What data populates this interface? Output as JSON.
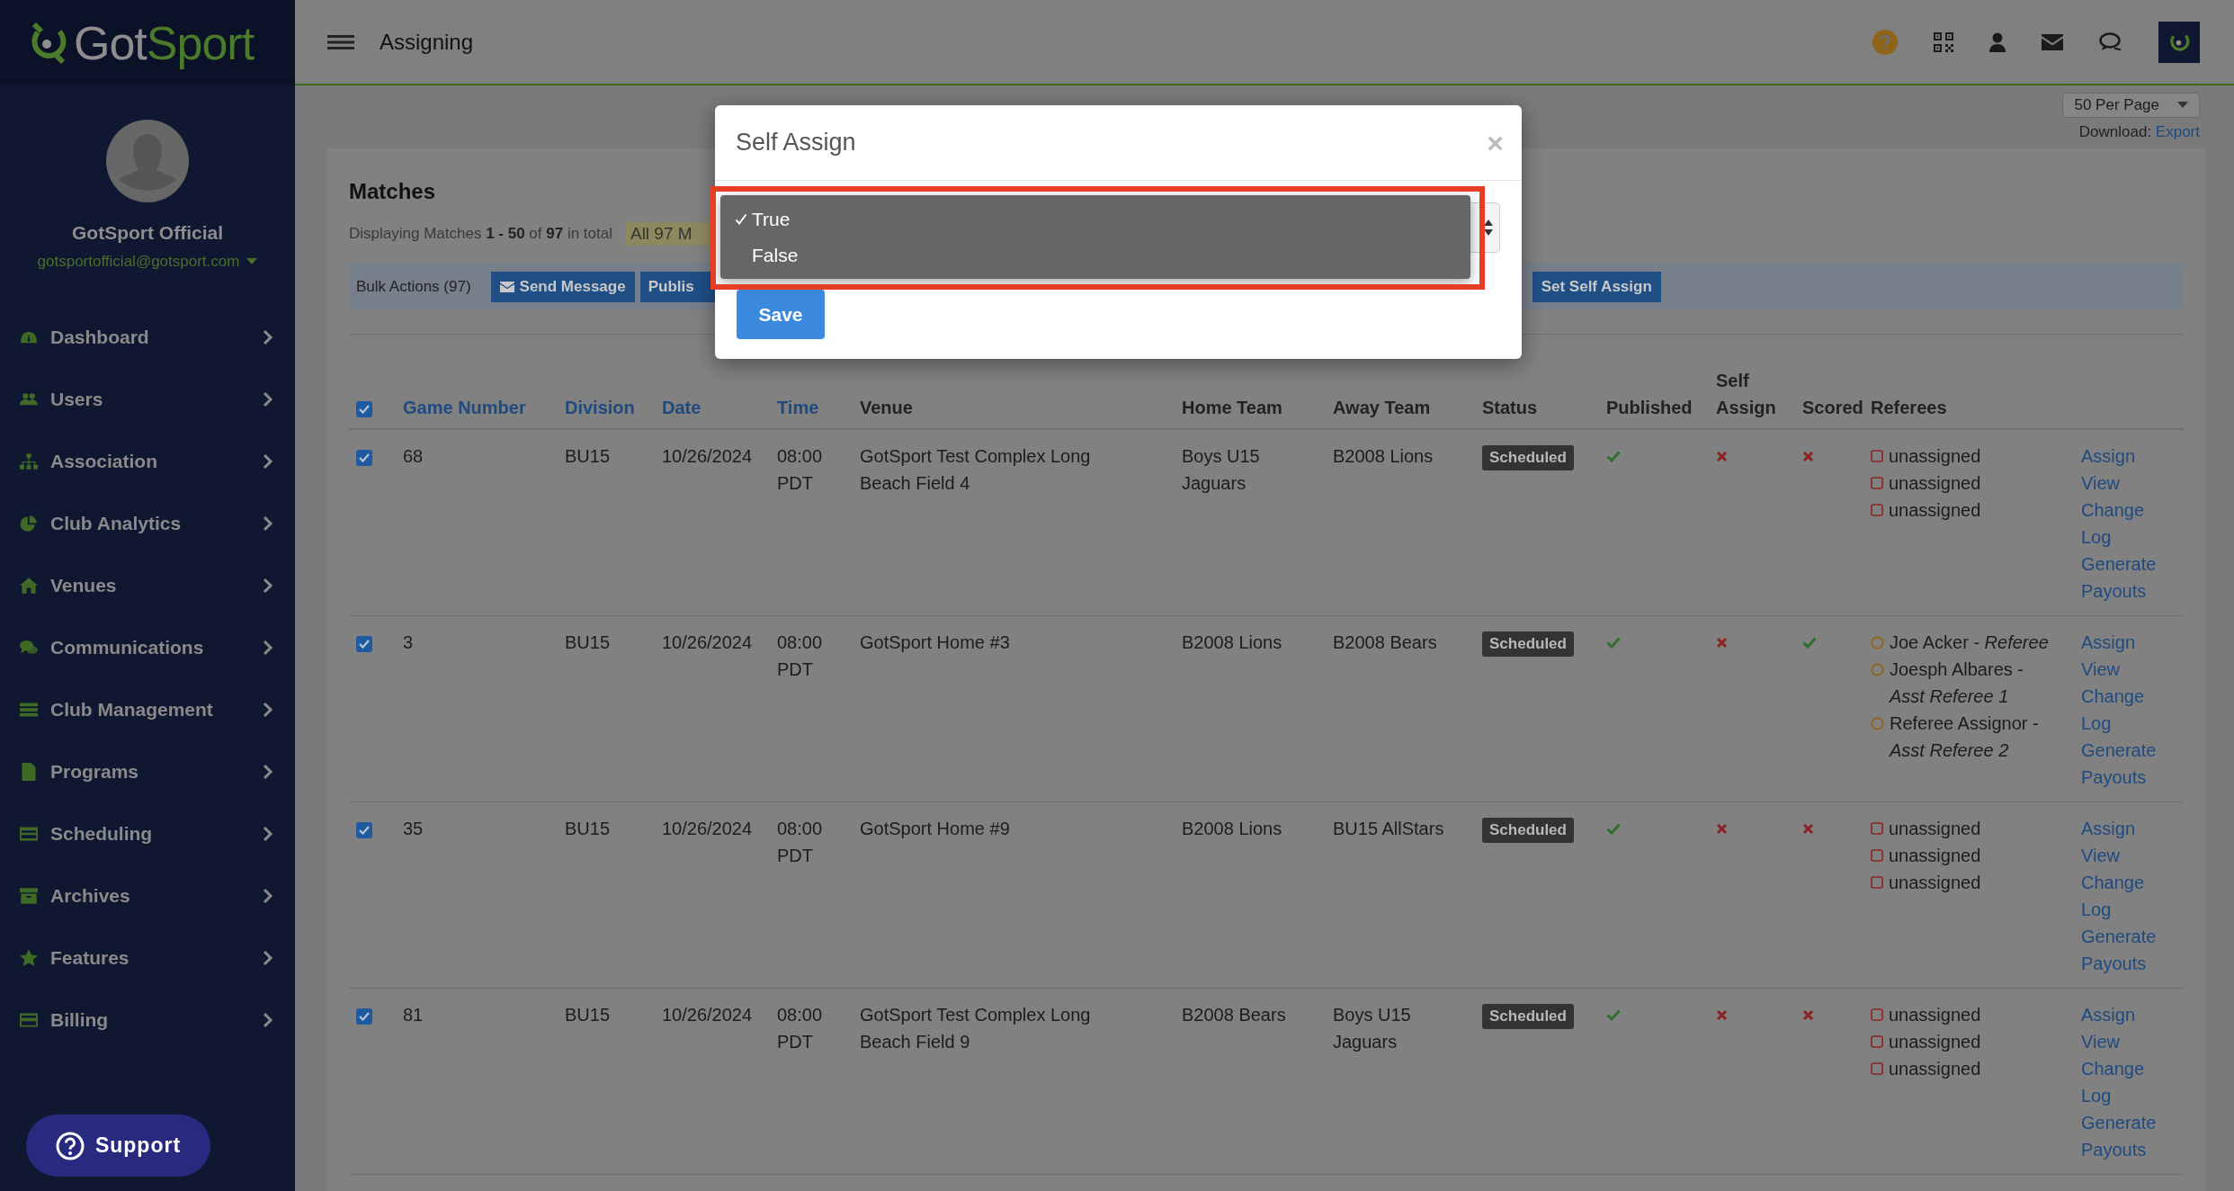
{
  "sidebar": {
    "logo": [
      {
        "text": "Got",
        "kind": "plain"
      },
      {
        "text": "Sport",
        "kind": "accent"
      }
    ],
    "user_name": "GotSport Official",
    "user_email": "gotsportofficial@gotsport.com",
    "items": [
      {
        "label": "Dashboard",
        "kind": "dashboard"
      },
      {
        "label": "Users",
        "kind": "users"
      },
      {
        "label": "Association",
        "kind": "association"
      },
      {
        "label": "Club Analytics",
        "kind": "analytics"
      },
      {
        "label": "Venues",
        "kind": "venues"
      },
      {
        "label": "Communications",
        "kind": "communications"
      },
      {
        "label": "Club Management",
        "kind": "management"
      },
      {
        "label": "Programs",
        "kind": "programs"
      },
      {
        "label": "Scheduling",
        "kind": "scheduling"
      },
      {
        "label": "Archives",
        "kind": "archives"
      },
      {
        "label": "Features",
        "kind": "features"
      },
      {
        "label": "Billing",
        "kind": "billing"
      }
    ],
    "support": "Support"
  },
  "header": {
    "title": "Assigning"
  },
  "toolbar": {
    "per_page": "50 Per Page",
    "download_label": "Download:",
    "download_link": "Export"
  },
  "matches": {
    "title": "Matches",
    "summary": "Displaying Matches **1 - 50** of **97** in total",
    "filter_chip": "All 97 M",
    "bulk_label": "Bulk Actions (97)",
    "bulk_buttons": [
      {
        "label": "Send Message",
        "kind": "envelope"
      },
      {
        "label": "Publis",
        "kind": "plain"
      },
      {
        "label": "Set Self Assign",
        "kind": "plain"
      }
    ],
    "select_all": true,
    "columns": [
      {
        "label": "Game Number",
        "sortable": true
      },
      {
        "label": "Division",
        "sortable": true
      },
      {
        "label": "Date",
        "sortable": true
      },
      {
        "label": "Time",
        "sortable": true
      },
      {
        "label": "Venue",
        "sortable": false
      },
      {
        "label": "Home Team",
        "sortable": false
      },
      {
        "label": "Away Team",
        "sortable": false
      },
      {
        "label": "Status",
        "sortable": false
      },
      {
        "label": "Published",
        "sortable": false
      },
      {
        "label": "Self Assign",
        "sortable": false
      },
      {
        "label": "Scored",
        "sortable": false
      },
      {
        "label": "Referees",
        "sortable": false
      }
    ],
    "rows": [
      {
        "checked": true,
        "game_number": "68",
        "division": "BU15",
        "date": "10/26/2024",
        "time": "08:00 PDT",
        "venue": "GotSport Test Complex Long Beach Field 4",
        "home_team": "Boys U15 Jaguars",
        "away_team": "B2008 Lions",
        "status": "Scheduled",
        "published": true,
        "self_assign": false,
        "scored": false,
        "referees": [
          {
            "kind": "unassigned",
            "text": "unassigned"
          },
          {
            "kind": "unassigned",
            "text": "unassigned"
          },
          {
            "kind": "unassigned",
            "text": "unassigned"
          }
        ],
        "actions": [
          "Assign",
          "View",
          "Change Log",
          "Generate Payouts"
        ]
      },
      {
        "checked": true,
        "game_number": "3",
        "division": "BU15",
        "date": "10/26/2024",
        "time": "08:00 PDT",
        "venue": "GotSport Home #3",
        "home_team": "B2008 Lions",
        "away_team": "B2008 Bears",
        "status": "Scheduled",
        "published": true,
        "self_assign": false,
        "scored": true,
        "referees": [
          {
            "kind": "assigned",
            "text": "Joe Acker - *Referee*"
          },
          {
            "kind": "assigned",
            "text": "Joesph Albares - *Asst Referee 1*"
          },
          {
            "kind": "assigned",
            "text": "Referee Assignor - *Asst Referee 2*"
          }
        ],
        "actions": [
          "Assign",
          "View",
          "Change Log",
          "Generate Payouts"
        ]
      },
      {
        "checked": true,
        "game_number": "35",
        "division": "BU15",
        "date": "10/26/2024",
        "time": "08:00 PDT",
        "venue": "GotSport Home #9",
        "home_team": "B2008 Lions",
        "away_team": "BU15 AllStars",
        "status": "Scheduled",
        "published": true,
        "self_assign": false,
        "scored": false,
        "referees": [
          {
            "kind": "unassigned",
            "text": "unassigned"
          },
          {
            "kind": "unassigned",
            "text": "unassigned"
          },
          {
            "kind": "unassigned",
            "text": "unassigned"
          }
        ],
        "actions": [
          "Assign",
          "View",
          "Change Log",
          "Generate Payouts"
        ]
      },
      {
        "checked": true,
        "game_number": "81",
        "division": "BU15",
        "date": "10/26/2024",
        "time": "08:00 PDT",
        "venue": "GotSport Test Complex Long Beach Field 9",
        "home_team": "B2008 Bears",
        "away_team": "Boys U15 Jaguars",
        "status": "Scheduled",
        "published": true,
        "self_assign": false,
        "scored": false,
        "referees": [
          {
            "kind": "unassigned",
            "text": "unassigned"
          },
          {
            "kind": "unassigned",
            "text": "unassigned"
          },
          {
            "kind": "unassigned",
            "text": "unassigned"
          }
        ],
        "actions": [
          "Assign",
          "View",
          "Change Log",
          "Generate Payouts"
        ]
      }
    ]
  },
  "modal": {
    "title": "Self Assign",
    "close": "×",
    "options": [
      {
        "label": "True",
        "selected": true
      },
      {
        "label": "False",
        "selected": false
      }
    ],
    "save": "Save"
  }
}
